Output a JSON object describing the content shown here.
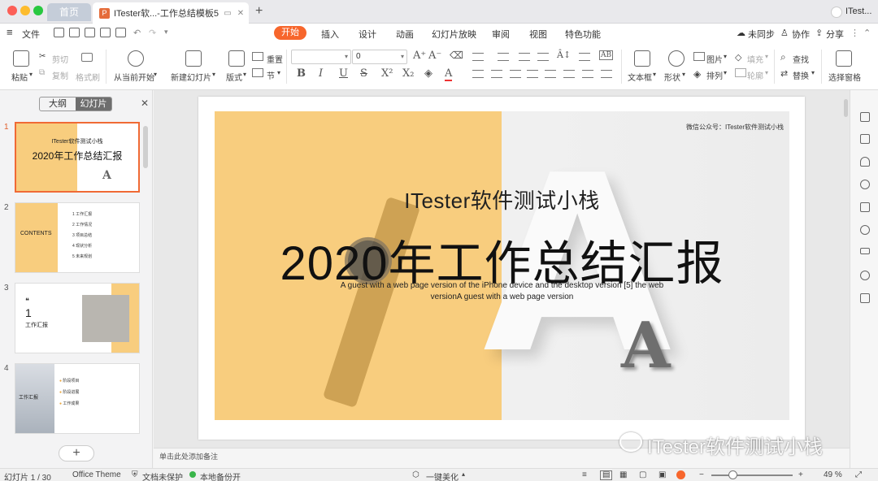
{
  "titlebar": {
    "home_tab": "首页",
    "doc_tab": "ITester软...-工作总结模板5",
    "user": "ITest..."
  },
  "menubar": {
    "file": "文件",
    "tabs": [
      "开始",
      "插入",
      "设计",
      "动画",
      "幻灯片放映",
      "审阅",
      "视图",
      "特色功能"
    ],
    "right": [
      "未同步",
      "协作",
      "分享"
    ]
  },
  "ribbon": {
    "paste": "粘贴",
    "cut": "剪切",
    "copy": "复制",
    "format_painter": "格式刷",
    "play_from_current": "从当前开始",
    "new_slide": "新建幻灯片",
    "layout": "版式",
    "reset": "重置",
    "section": "节",
    "font_size": "0",
    "textbox": "文本框",
    "shape": "形状",
    "picture": "图片",
    "fill": "填充",
    "arrange": "排列",
    "outline": "轮廓",
    "find": "查找",
    "replace": "替换",
    "select_pane": "选择窗格"
  },
  "leftpanel": {
    "outline_tab": "大纲",
    "slides_tab": "幻灯片",
    "thumbs": [
      {
        "num": "1",
        "title": "ITester软件测试小栈",
        "main": "2020年工作总结汇报"
      },
      {
        "num": "2",
        "heading": "CONTENTS",
        "items": [
          "工作汇报",
          "工作情况",
          "项目总结",
          "现状分析",
          "未来规划"
        ]
      },
      {
        "num": "3",
        "number": "1",
        "heading": "工作汇报"
      },
      {
        "num": "4",
        "heading": "工作汇报",
        "items": [
          "阶段项目",
          "阶段进展",
          "工作成果"
        ]
      }
    ]
  },
  "slide": {
    "wechat": "微信公众号：ITester软件测试小栈",
    "subtitle": "ITester软件测试小栈",
    "title": "2020年工作总结汇报",
    "desc": "A guest with a web page version of the iPhone device and the desktop version [5] the web versionA guest with a web page version",
    "letter_big": "A",
    "letter_stone": "A"
  },
  "notes_hint": "单击此处添加备注",
  "watermark": "ITester软件测试小栈",
  "status": {
    "slide_count": "幻灯片 1 / 30",
    "theme": "Office Theme",
    "protect": "文档未保护",
    "backup": "本地备份开",
    "beautify": "一键美化",
    "zoom": "49 %"
  },
  "colors": {
    "accent": "#f7662c",
    "slide_yellow": "#f8cd7e"
  }
}
